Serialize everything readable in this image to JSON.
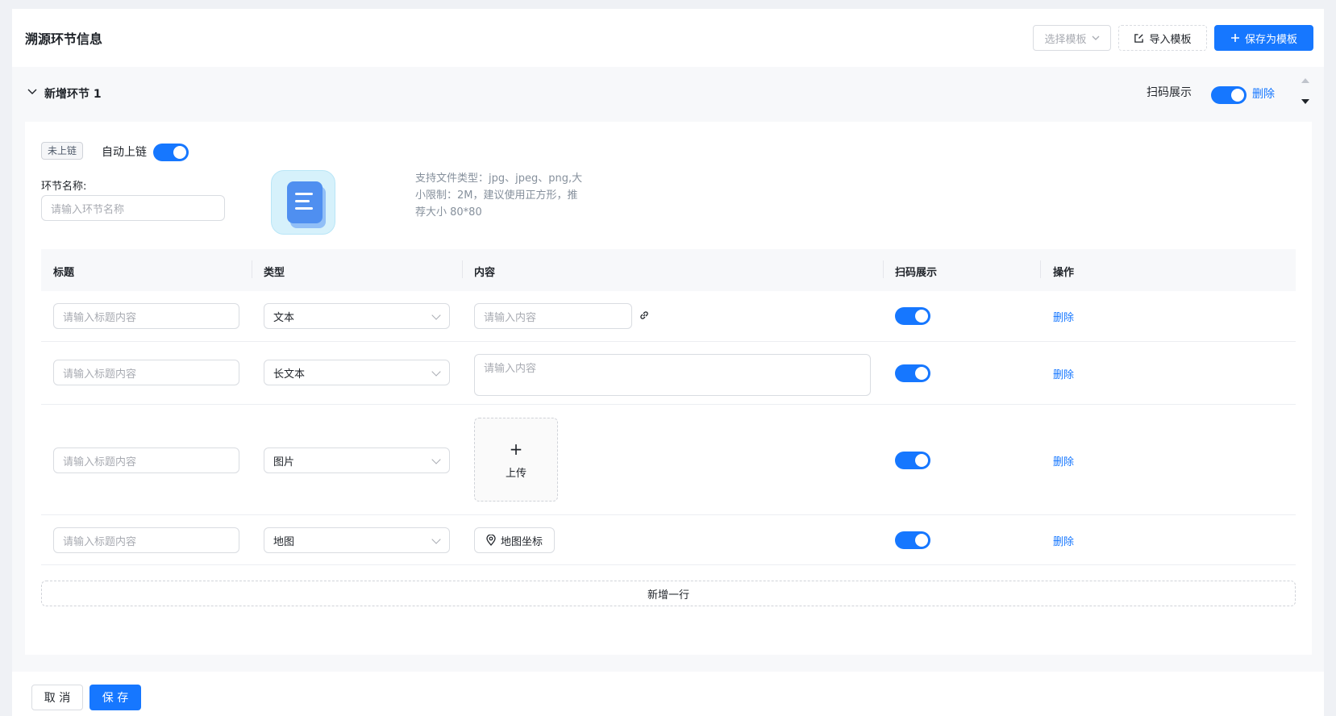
{
  "header": {
    "title": "溯源环节信息",
    "select_template": "选择模板",
    "import_template": "导入模板",
    "save_as_template": "保存为模板"
  },
  "section": {
    "title": "新增环节 1",
    "scan_display_label": "扫码展示",
    "delete_label": "删除",
    "chain_tag": "未上链",
    "auto_chain_label": "自动上链",
    "name_label": "环节名称:",
    "name_placeholder": "请输入环节名称",
    "upload_hint": "支持文件类型：jpg、jpeg、png,大小限制：2M，建议使用正方形，推荐大小 80*80"
  },
  "table": {
    "columns": [
      "标题",
      "类型",
      "内容",
      "扫码展示",
      "操作"
    ],
    "title_placeholder": "请输入标题内容",
    "content_placeholder": "请输入内容",
    "rows": [
      {
        "type": "文本",
        "action": "删除",
        "scan": true
      },
      {
        "type": "长文本",
        "action": "删除",
        "scan": true
      },
      {
        "type": "图片",
        "action": "删除",
        "scan": true,
        "upload_label": "上传"
      },
      {
        "type": "地图",
        "action": "删除",
        "scan": true,
        "map_label": "地图坐标"
      }
    ],
    "add_row": "新增一行"
  },
  "footer": {
    "cancel": "取 消",
    "save": "保 存"
  },
  "colors": {
    "primary": "#1677ff",
    "background": "#eff1f5"
  }
}
